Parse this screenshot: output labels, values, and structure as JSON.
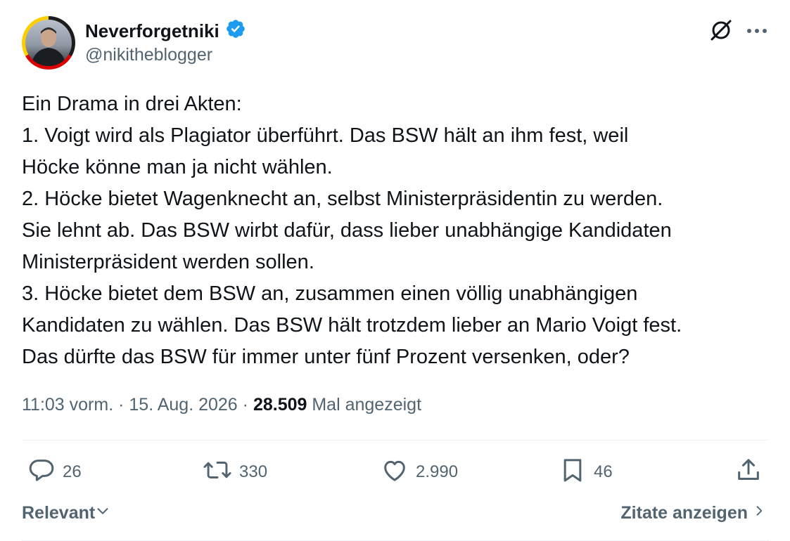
{
  "author": {
    "display_name": "Neverforgetniki",
    "handle": "@nikitheblogger",
    "verified_icon": "verified-badge-icon",
    "verified_color": "#1d9bf0"
  },
  "tweet": {
    "lines": [
      "Ein Drama in drei Akten:",
      "1. Voigt wird als Plagiator überführt. Das BSW hält an ihm fest, weil",
      "Höcke könne man ja nicht wählen.",
      "2. Höcke bietet Wagenknecht an, selbst Ministerpräsidentin zu werden.",
      "Sie lehnt ab. Das BSW wirbt dafür, dass lieber unabhängige Kandidaten",
      "Ministerpräsident werden sollen.",
      "3. Höcke bietet dem BSW an, zusammen einen völlig unabhängigen",
      "Kandidaten zu wählen. Das BSW hält trotzdem lieber an Mario Voigt fest.",
      "Das dürfte das BSW für immer unter fünf Prozent versenken, oder?"
    ]
  },
  "meta": {
    "time": "11:03 vorm.",
    "separator": "·",
    "date": "15. Aug. 2026",
    "views_count": "28.509",
    "views_label": "Mal angezeigt"
  },
  "actions": {
    "replies": "26",
    "reposts": "330",
    "likes": "2.990",
    "bookmarks": "46"
  },
  "footer": {
    "sort_label": "Relevant",
    "quotes_label": "Zitate anzeigen"
  },
  "colors": {
    "text": "#0f1419",
    "secondary": "#536471",
    "divider": "#eff3f4",
    "accent": "#1d9bf0"
  }
}
